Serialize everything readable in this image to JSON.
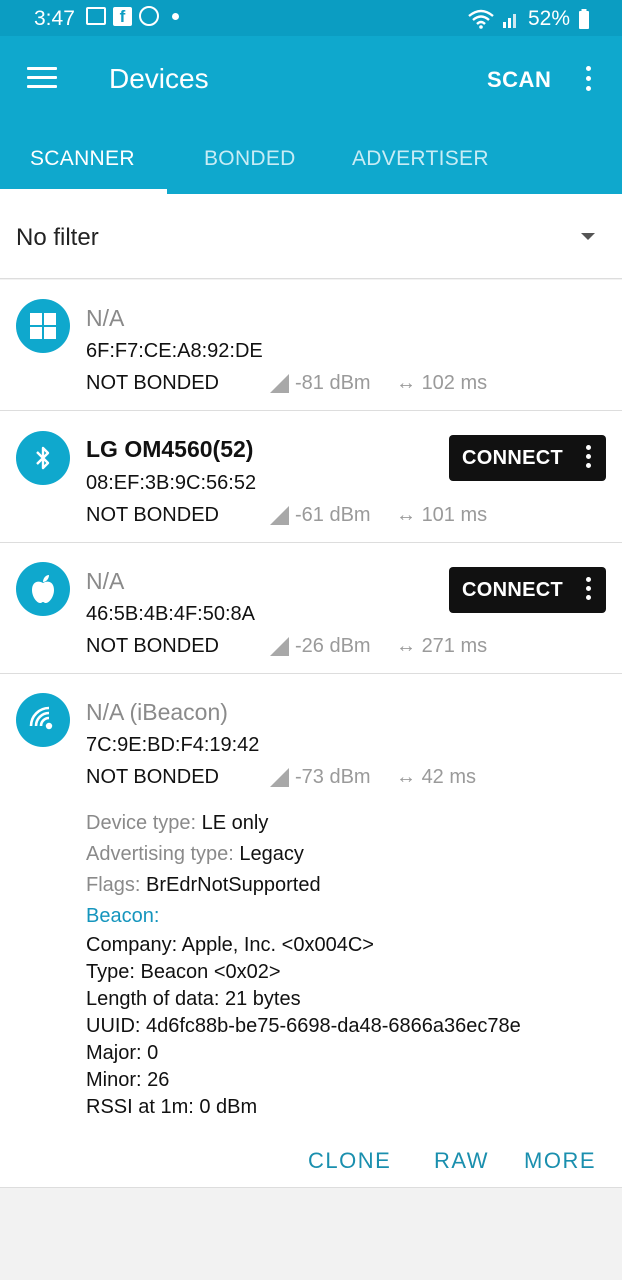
{
  "status_bar": {
    "time": "3:47",
    "battery": "52%"
  },
  "app_bar": {
    "title": "Devices",
    "scan_label": "SCAN"
  },
  "tabs": [
    {
      "label": "SCANNER",
      "active": true
    },
    {
      "label": "BONDED",
      "active": false
    },
    {
      "label": "ADVERTISER",
      "active": false
    }
  ],
  "filter": {
    "label": "No filter"
  },
  "devices": [
    {
      "icon": "windows-icon",
      "name": "N/A",
      "address": "6F:F7:CE:A8:92:DE",
      "bond": "NOT BONDED",
      "rssi": "-81 dBm",
      "interval": "102 ms"
    },
    {
      "icon": "bluetooth-icon",
      "name": "LG OM4560(52)",
      "address": "08:EF:3B:9C:56:52",
      "bond": "NOT BONDED",
      "rssi": "-61 dBm",
      "interval": "101 ms",
      "connect_label": "CONNECT"
    },
    {
      "icon": "apple-icon",
      "name": "N/A",
      "address": "46:5B:4B:4F:50:8A",
      "bond": "NOT BONDED",
      "rssi": "-26 dBm",
      "interval": "271 ms",
      "connect_label": "CONNECT"
    },
    {
      "icon": "beacon-icon",
      "name": "N/A  (iBeacon)",
      "address": "7C:9E:BD:F4:19:42",
      "bond": "NOT BONDED",
      "rssi": "-73 dBm",
      "interval": "42 ms",
      "details": {
        "device_type_label": "Device type:",
        "device_type": "LE only",
        "adv_type_label": "Advertising type:",
        "adv_type": "Legacy",
        "flags_label": "Flags:",
        "flags": "BrEdrNotSupported",
        "beacon_heading": "Beacon:",
        "beacon_lines": [
          "Company: Apple, Inc. <0x004C>",
          "Type: Beacon <0x02>",
          "Length of data: 21 bytes",
          "UUID: 4d6fc88b-be75-6698-da48-6866a36ec78e",
          "Major: 0",
          "Minor: 26",
          "RSSI at 1m: 0 dBm"
        ]
      },
      "actions": {
        "clone": "CLONE",
        "raw": "RAW",
        "more": "MORE"
      }
    }
  ]
}
